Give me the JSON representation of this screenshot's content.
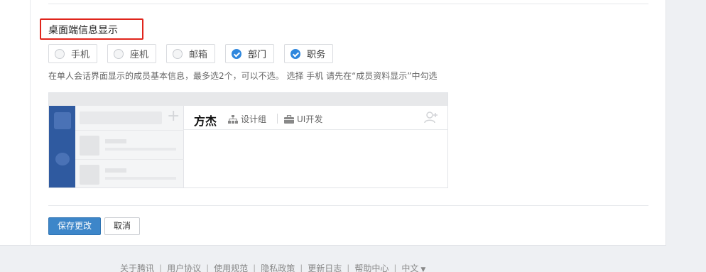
{
  "section": {
    "title": "桌面端信息显示"
  },
  "options": [
    {
      "label": "手机",
      "checked": false
    },
    {
      "label": "座机",
      "checked": false
    },
    {
      "label": "邮箱",
      "checked": false
    },
    {
      "label": "部门",
      "checked": true
    },
    {
      "label": "职务",
      "checked": true
    }
  ],
  "hint": "在单人会话界面显示的成员基本信息，最多选2个，可以不选。 选择 手机 请先在“成员资料显示”中勾选",
  "preview": {
    "name": "方杰",
    "department": "设计组",
    "position": "UI开发"
  },
  "actions": {
    "save": "保存更改",
    "cancel": "取消"
  },
  "footer": {
    "links": [
      "关于腾讯",
      "用户协议",
      "使用规范",
      "隐私政策",
      "更新日志",
      "帮助中心"
    ],
    "language": "中文",
    "separator": "|"
  },
  "colors": {
    "accent": "#3d86c9",
    "highlight_border": "#e0251c",
    "check": "#2f87dd"
  }
}
